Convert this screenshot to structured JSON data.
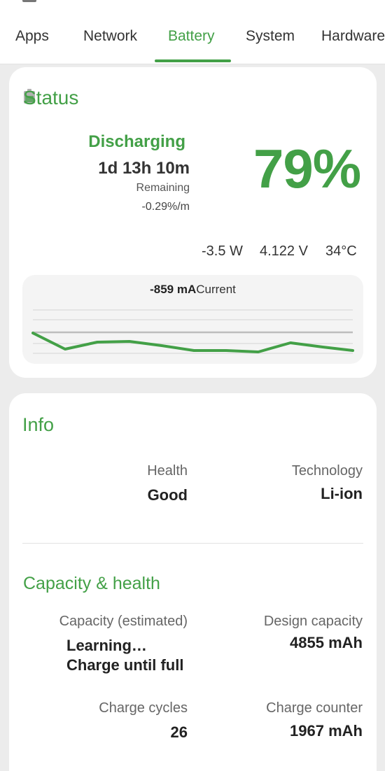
{
  "tabs": [
    {
      "label": "Apps"
    },
    {
      "label": "Network"
    },
    {
      "label": "Battery"
    },
    {
      "label": "System"
    },
    {
      "label": "Hardware"
    }
  ],
  "active_tab": "Battery",
  "accent_color": "#43a047",
  "status": {
    "title": "Status",
    "state": "Discharging",
    "time_left": "1d 13h 10m",
    "remaining_label": "Remaining",
    "rate": "-0.29%/m",
    "percent": "79%",
    "power": "-3.5 W",
    "voltage": "4.122 V",
    "temperature": "34°C",
    "current_value": "-859 mA",
    "current_label": "Current"
  },
  "info": {
    "title": "Info",
    "health_label": "Health",
    "health_value": "Good",
    "technology_label": "Technology",
    "technology_value": "Li-ion"
  },
  "capacity": {
    "title": "Capacity & health",
    "estimated_label": "Capacity (estimated)",
    "estimated_line1": "Learning…",
    "estimated_line2": "Charge until full",
    "design_label": "Design capacity",
    "design_value": "4855 mAh",
    "cycles_label": "Charge cycles",
    "cycles_value": "26",
    "counter_label": "Charge counter",
    "counter_value": "1967 mAh"
  }
}
